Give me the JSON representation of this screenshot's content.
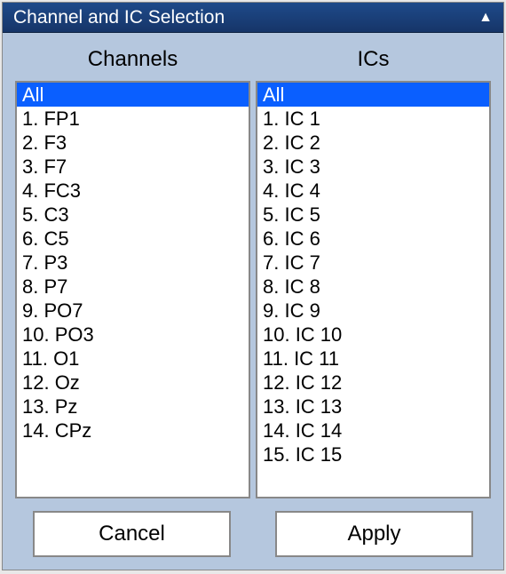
{
  "titlebar": {
    "text": "Channel  and IC Selection"
  },
  "headers": {
    "channels": "Channels",
    "ics": "ICs"
  },
  "channels": {
    "selected_index": 0,
    "items": [
      "All",
      "1. FP1",
      "2. F3",
      "3. F7",
      "4. FC3",
      "5. C3",
      "6. C5",
      "7. P3",
      "8. P7",
      "9. PO7",
      "10. PO3",
      "11. O1",
      "12. Oz",
      "13. Pz",
      "14. CPz"
    ]
  },
  "ics": {
    "selected_index": 0,
    "items": [
      "All",
      "1. IC 1",
      "2. IC 2",
      "3. IC 3",
      "4. IC 4",
      "5. IC 5",
      "6. IC 6",
      "7. IC 7",
      "8. IC 8",
      "9. IC 9",
      "10. IC 10",
      "11. IC 11",
      "12. IC 12",
      "13. IC 13",
      "14. IC 14",
      "15. IC 15"
    ]
  },
  "buttons": {
    "cancel": "Cancel",
    "apply": "Apply"
  }
}
